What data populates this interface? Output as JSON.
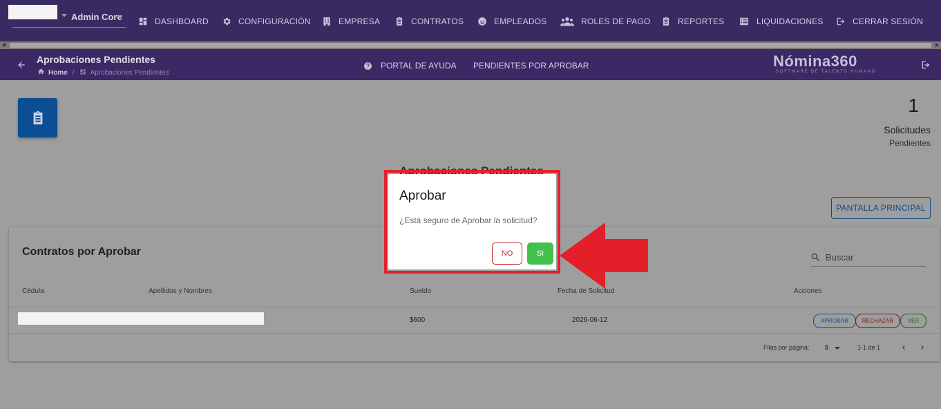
{
  "topnav": {
    "user_name": "Admin Core",
    "items": [
      {
        "label": "DASHBOARD",
        "icon": "dashboard-icon"
      },
      {
        "label": "CONFIGURACIÓN",
        "icon": "gear-icon"
      },
      {
        "label": "EMPRESA",
        "icon": "building-icon"
      },
      {
        "label": "CONTRATOS",
        "icon": "clipboard-icon"
      },
      {
        "label": "EMPLEADOS",
        "icon": "face-icon"
      },
      {
        "label": "ROLES DE PAGO",
        "icon": "people-icon"
      },
      {
        "label": "REPORTES",
        "icon": "clipboard-icon"
      },
      {
        "label": "LIQUIDACIONES",
        "icon": "list-icon"
      },
      {
        "label": "CERRAR SESIÓN",
        "icon": "logout-icon"
      }
    ]
  },
  "subheader": {
    "title": "Aprobaciones Pendientes",
    "breadcrumb_home": "Home",
    "breadcrumb_sep": "/",
    "breadcrumb_current": "Aprobaciones Pendientes",
    "help_label": "PORTAL DE AYUDA",
    "pending_label": "PENDIENTES POR APROBAR",
    "brand": "Nómina360",
    "brand_sub": "SOFTWARE DE TALENTO HUMANO"
  },
  "summary": {
    "count": "1",
    "label": "Solicitudes",
    "sublabel": "Pendientes",
    "section_title": "Aprobaciones Pendientes",
    "main_button": "PANTALLA PRINCIPAL"
  },
  "table": {
    "title": "Contratos por Aprobar",
    "search_placeholder": "Buscar",
    "headers": [
      "Cédula",
      "Apellidos y Nombres",
      "Sueldo",
      "Fecha de Solicitud",
      "Acciones"
    ],
    "rows": [
      {
        "sueldo": "$600",
        "fecha": "2026-06-12"
      }
    ],
    "actions": {
      "approve": "APROBAR",
      "reject": "RECHAZAR",
      "view": "VER"
    },
    "pager": {
      "rows_label": "Filas por página:",
      "rows_value": "5",
      "range": "1-1 de 1"
    }
  },
  "modal": {
    "title": "Aprobar",
    "message": "¿Está seguro de Aprobar la solicitud?",
    "no_label": "NO",
    "yes_label": "SI"
  },
  "colors": {
    "nav_bg": "#3a2a62",
    "annotation_red": "#e3202a",
    "yes_green": "#44c04f",
    "primary_blue": "#0b4e93"
  }
}
